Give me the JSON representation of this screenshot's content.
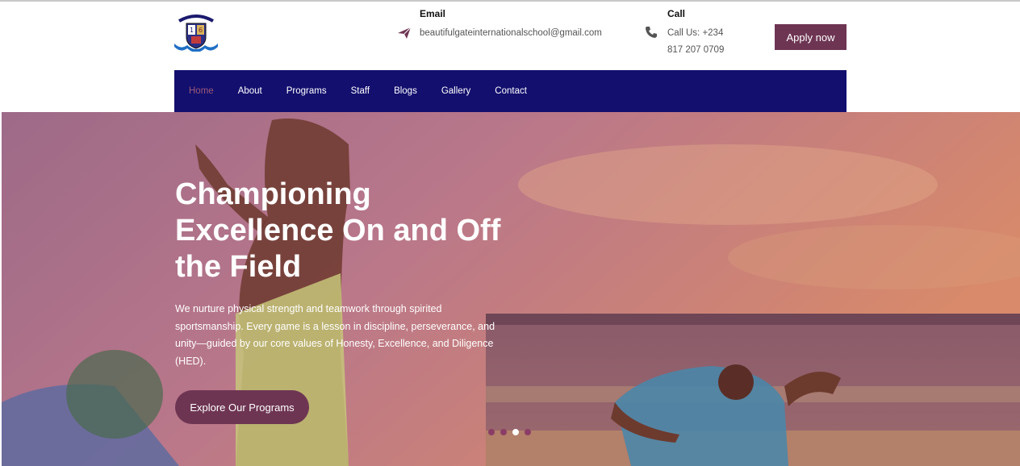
{
  "header": {
    "logo_name": "school-crest",
    "email": {
      "title": "Email",
      "value": "beautifulgateinternationalschool@gmail.com",
      "icon": "paper-plane-icon"
    },
    "call": {
      "title": "Call",
      "line1": "Call Us: +234",
      "line2": "817 207 0709",
      "icon": "phone-icon"
    },
    "apply_label": "Apply now"
  },
  "nav": {
    "items": [
      {
        "label": "Home"
      },
      {
        "label": "About"
      },
      {
        "label": "Programs"
      },
      {
        "label": "Staff"
      },
      {
        "label": "Blogs"
      },
      {
        "label": "Gallery"
      },
      {
        "label": "Contact"
      }
    ],
    "active": "Home"
  },
  "hero": {
    "title_line1": "Championing",
    "title_line2": "Excellence On and Off",
    "title_line3": "the Field",
    "description": "We nurture physical strength and teamwork through spirited sportsmanship. Every game is a lesson in discipline, perseverance, and unity—guided by our core values of Honesty, Excellence, and Diligence (HED).",
    "cta_label": "Explore Our Programs",
    "slides_total": 4,
    "slide_active": 3
  },
  "colors": {
    "accent": "#6e3553",
    "nav_bg": "#130f6e",
    "active_nav_text": "#9c5a7a"
  }
}
